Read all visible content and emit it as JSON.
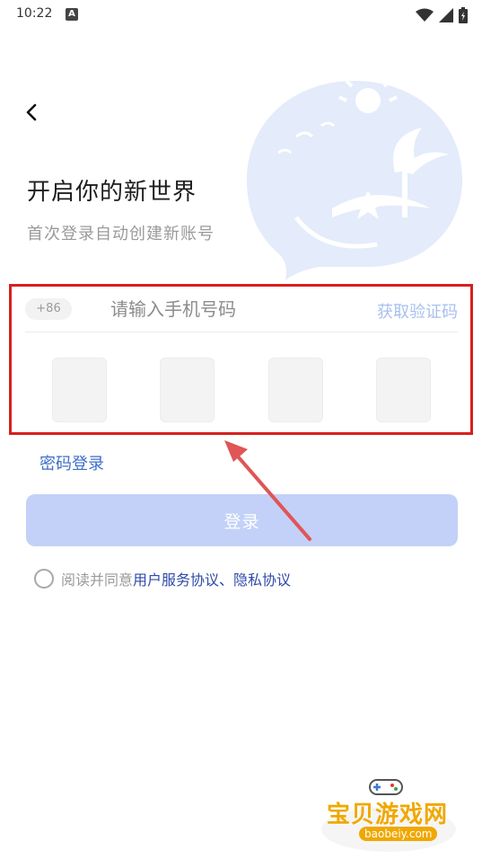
{
  "status_bar": {
    "time": "10:22",
    "notification_icon": "a-icon",
    "icons": [
      "wifi-icon",
      "signal-icon",
      "battery-icon"
    ]
  },
  "header": {
    "back_icon": "chevron-left-icon"
  },
  "hero": {
    "title": "开启你的新世界",
    "subtitle": "首次登录自动创建新账号"
  },
  "phone_form": {
    "country_code": "+86",
    "phone_placeholder": "请输入手机号码",
    "phone_value": "",
    "get_code_label": "获取验证码",
    "code_boxes": [
      "",
      "",
      "",
      ""
    ]
  },
  "alt_login": {
    "password_login_label": "密码登录"
  },
  "actions": {
    "login_label": "登录"
  },
  "agreement": {
    "prefix": "阅读并同意",
    "user_agreement": "用户服务协议",
    "separator": "、",
    "privacy_policy": "隐私协议",
    "checked": false
  },
  "watermark": {
    "site_name": "宝贝游戏网",
    "site_url": "baobeiy.com"
  },
  "colors": {
    "accent": "#3d6ec9",
    "login_disabled": "#c3d1f8",
    "highlight_box": "#d62020",
    "link": "#2e4aa8"
  }
}
